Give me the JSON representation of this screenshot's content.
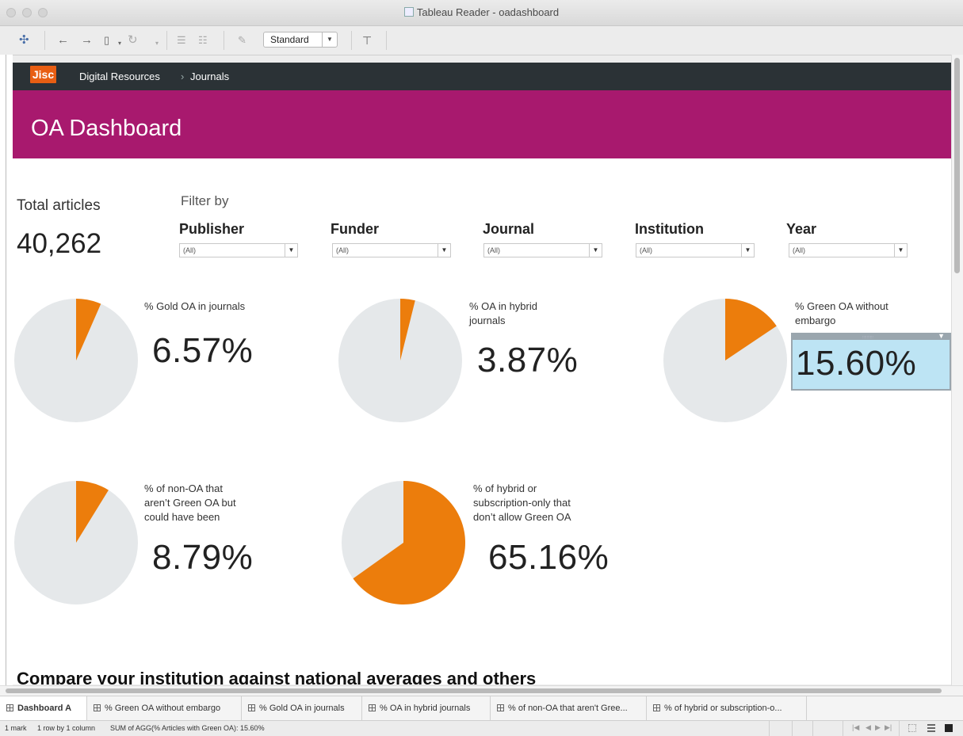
{
  "window": {
    "title": "Tableau Reader - oadashboard"
  },
  "toolbar": {
    "view_mode": "Standard"
  },
  "header": {
    "logo": "Jisc",
    "breadcrumb": [
      "Digital Resources",
      "›",
      "Journals"
    ],
    "title": "OA Dashboard"
  },
  "summary": {
    "total_label": "Total articles",
    "total_value": "40,262"
  },
  "filters": {
    "title": "Filter by",
    "items": [
      {
        "name": "Publisher",
        "value": "(All)"
      },
      {
        "name": "Funder",
        "value": "(All)"
      },
      {
        "name": "Journal",
        "value": "(All)"
      },
      {
        "name": "Institution",
        "value": "(All)"
      },
      {
        "name": "Year",
        "value": "(All)"
      }
    ]
  },
  "kpis": [
    {
      "label": [
        "% Gold OA in journals"
      ],
      "value": "6.57%",
      "fraction": 0.0657
    },
    {
      "label": [
        "% OA in hybrid",
        "journals"
      ],
      "value": "3.87%",
      "fraction": 0.0387
    },
    {
      "label": [
        "% Green OA without",
        "embargo"
      ],
      "value": "15.60%",
      "fraction": 0.156
    },
    {
      "label": [
        "% of non-OA that",
        "aren’t Green OA but",
        "could have been"
      ],
      "value": "8.79%",
      "fraction": 0.0879
    },
    {
      "label": [
        "% of hybrid or",
        "subscription-only that",
        "don’t allow Green OA"
      ],
      "value": "65.16%",
      "fraction": 0.6516
    }
  ],
  "section": {
    "compare_title": "Compare your institution against national averages and others"
  },
  "tabs": [
    {
      "label": "Dashboard A",
      "active": true
    },
    {
      "label": "% Green OA without embargo"
    },
    {
      "label": "% Gold OA in journals"
    },
    {
      "label": "% OA in hybrid journals"
    },
    {
      "label": "% of non-OA that aren't Gree..."
    },
    {
      "label": "% of hybrid or subscription-o..."
    }
  ],
  "status": {
    "marks": "1 mark",
    "dims": "1 row by 1 column",
    "summary": "SUM of AGG(% Articles with Green OA): 15.60%"
  },
  "colors": {
    "slice": "#ec7d0c",
    "pie_bg": "#e5e8ea",
    "banner": "#a8196e",
    "navbar": "#2b3236",
    "highlight": "#bde4f4"
  },
  "icons": [
    "tableau-logo-icon",
    "back-icon",
    "forward-icon",
    "data-source-icon",
    "refresh-icon",
    "sort-ascending-icon",
    "sort-descending-icon",
    "pin-icon",
    "presentation-icon"
  ]
}
